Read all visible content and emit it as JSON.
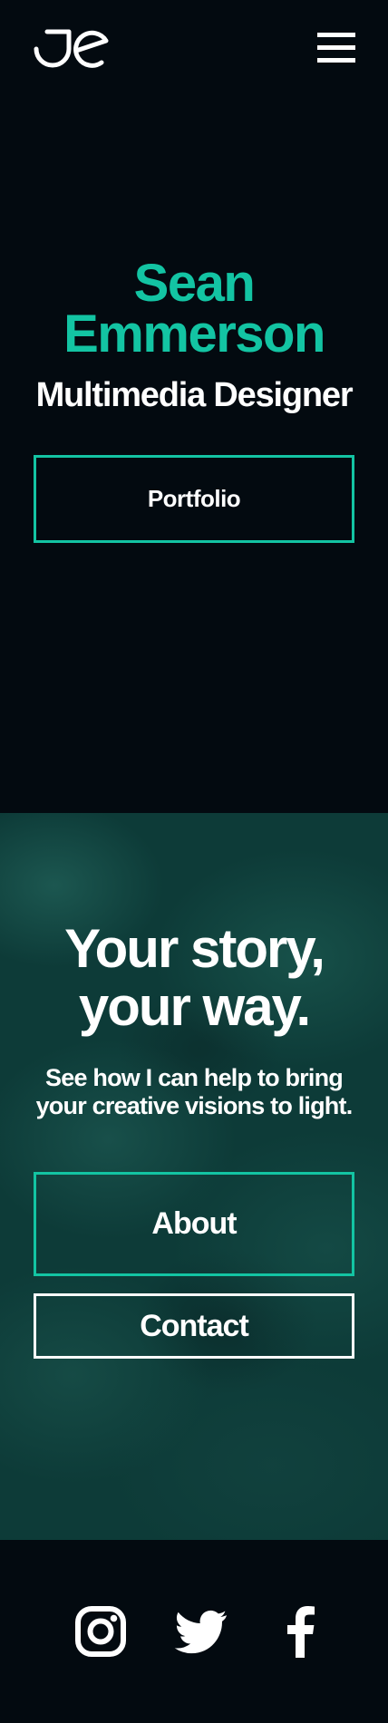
{
  "header": {
    "logo_icon": "je-monogram-logo",
    "menu_icon": "hamburger-menu-icon"
  },
  "hero": {
    "name_first": "Sean",
    "name_last": "Emmerson",
    "role": "Multimedia Designer",
    "portfolio_button": "Portfolio"
  },
  "story": {
    "title_line1": "Your story,",
    "title_line2": "your way.",
    "subtitle_line1": "See how I can help to bring",
    "subtitle_line2": "your creative visions to light.",
    "about_button": "About",
    "contact_button": "Contact"
  },
  "footer": {
    "social": [
      "instagram-icon",
      "twitter-icon",
      "facebook-icon"
    ]
  },
  "colors": {
    "background": "#030a10",
    "accent": "#13c4a3",
    "section_bg": "#0d3b38",
    "text": "#ffffff"
  }
}
